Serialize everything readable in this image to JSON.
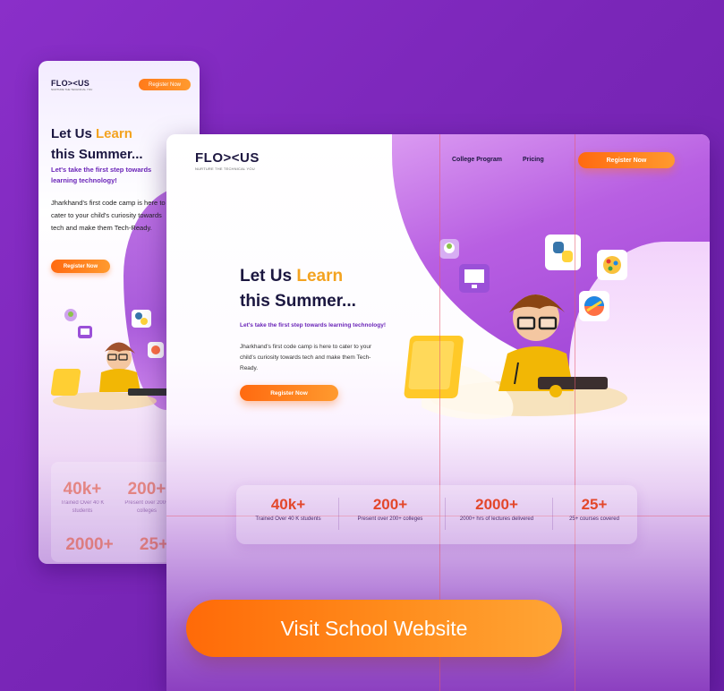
{
  "mobile": {
    "logo": "FLO><US",
    "tagline": "NURTURE THE TECHNICAL YOU",
    "register_top": "Register Now",
    "title_a": "Let Us ",
    "title_b": "Learn",
    "title_c": "this Summer...",
    "subtitle": "Let's take the first step towards learning technology!",
    "description": "Jharkhand's first code camp is here to cater to your child's curiosity towards tech and make them Tech-Ready.",
    "register": "Register Now",
    "stats": [
      {
        "num": "40k+",
        "label": "Trained Over 40 K students"
      },
      {
        "num": "200+",
        "label": "Present over 200+ colleges"
      },
      {
        "num": "2000+",
        "label": ""
      },
      {
        "num": "25+",
        "label": ""
      }
    ]
  },
  "desktop": {
    "logo": "FLO><US",
    "tagline": "NURTURE THE TECHNICAL YOU",
    "nav": [
      "College Program",
      "Pricing"
    ],
    "register_top": "Register Now",
    "title_a": "Let Us  ",
    "title_b": "Learn",
    "title_c": "this Summer...",
    "subtitle": "Let's take the first step towards learning technology!",
    "description": "Jharkhand's first code camp is here to cater to your child's curiosity towards tech and make them Tech-Ready.",
    "register": "Register Now",
    "stats": [
      {
        "num": "40k+",
        "label": "Trained Over 40 K students"
      },
      {
        "num": "200+",
        "label": "Present over 200+ colleges"
      },
      {
        "num": "2000+",
        "label": "2000+ hrs of lectures delivered"
      },
      {
        "num": "25+",
        "label": "25+ courses covered"
      }
    ]
  },
  "cta": {
    "label": "Visit School Website"
  },
  "colors": {
    "accent": "#ff7a1a",
    "brand_purple": "#7a26b8",
    "stat_red": "#e3472b",
    "learn_gold": "#f3a320"
  },
  "icons": [
    "python-icon",
    "paint-palette-icon",
    "monitor-icon",
    "plant-pot-icon",
    "beach-ball-icon"
  ]
}
